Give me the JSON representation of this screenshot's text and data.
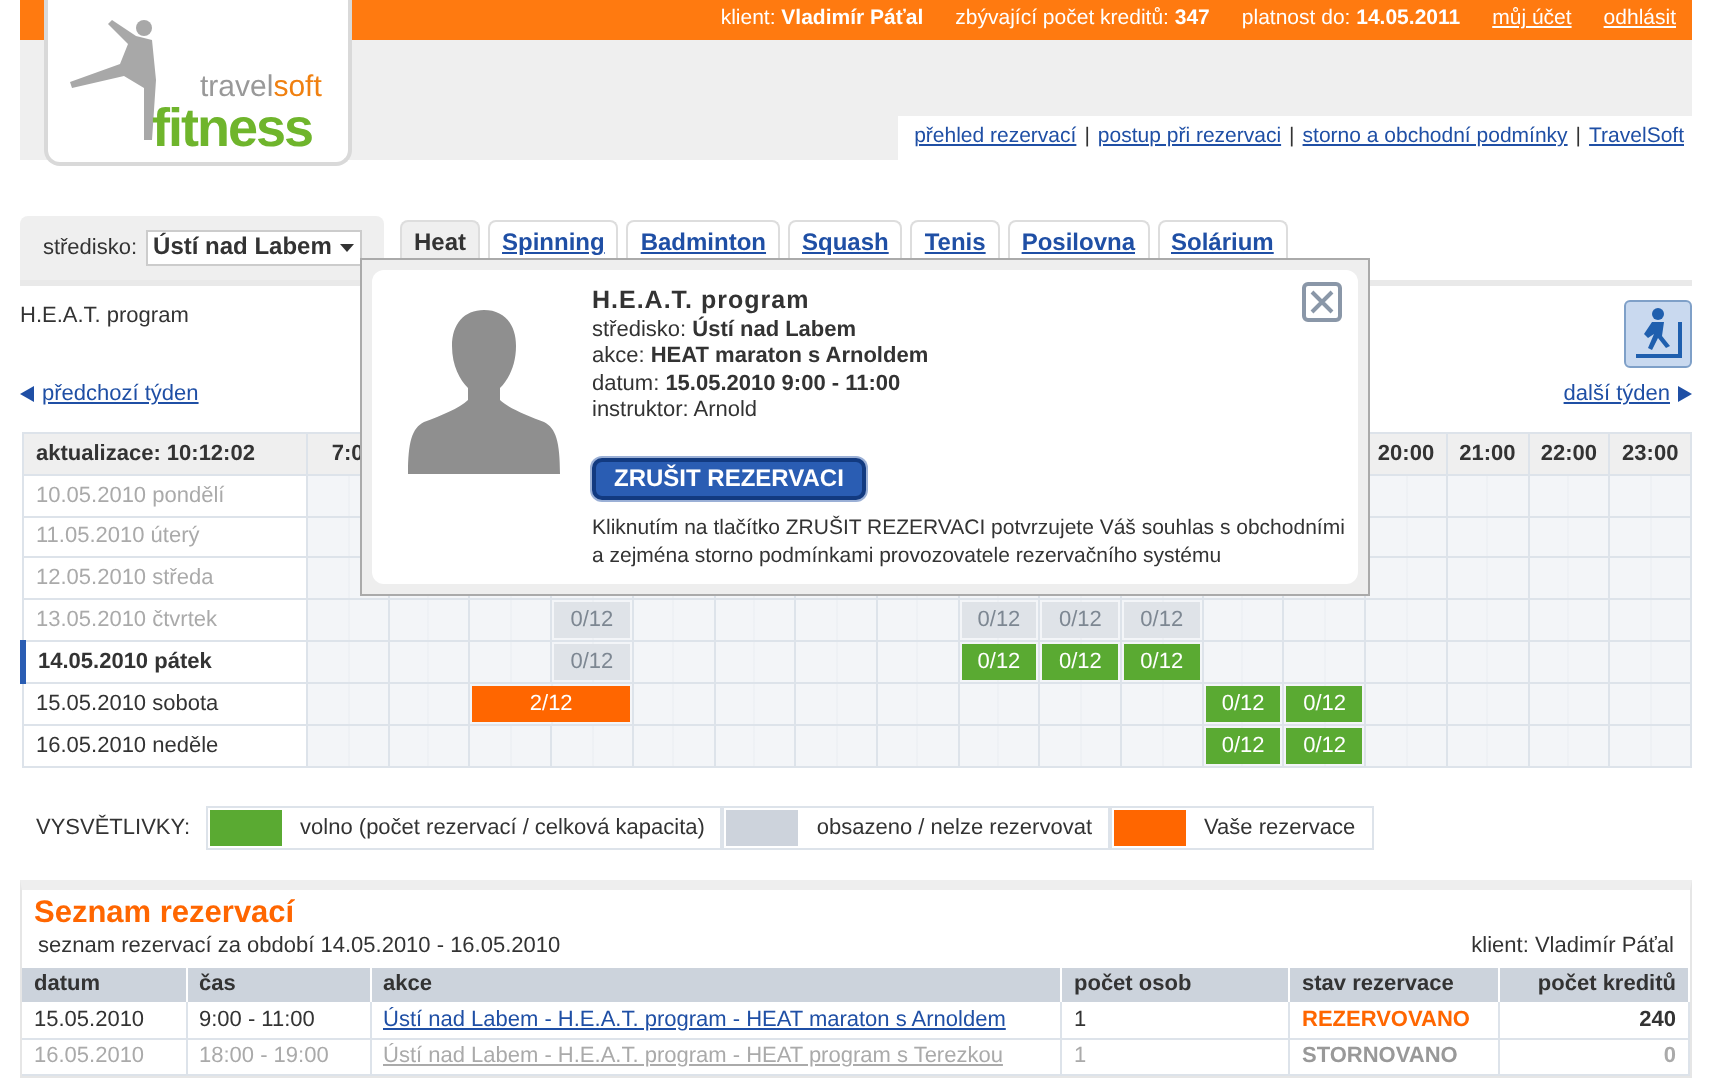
{
  "top_bar": {
    "info": [
      {
        "label": "klient:",
        "value": "Vladimír Páťal"
      },
      {
        "label": "zbývající počet kreditů:",
        "value": "347"
      },
      {
        "label": "platnost do:",
        "value": "14.05.2011"
      }
    ],
    "links": [
      "můj účet",
      "odhlásit"
    ]
  },
  "logo": {
    "part1": "travel",
    "part2": "soft",
    "part3": "fitness"
  },
  "nav_links": [
    "přehled rezervací",
    "postup při rezervaci",
    "storno a obchodní podmínky",
    "TravelSoft"
  ],
  "nav_separator": "|",
  "center": {
    "label": "středisko:",
    "value": "Ústí nad Labem"
  },
  "tabs": [
    {
      "label": "Heat",
      "selected": true
    },
    {
      "label": "Spinning",
      "selected": false
    },
    {
      "label": "Badminton",
      "selected": false
    },
    {
      "label": "Squash",
      "selected": false
    },
    {
      "label": "Tenis",
      "selected": false
    },
    {
      "label": "Posilovna",
      "selected": false
    },
    {
      "label": "Solárium",
      "selected": false
    }
  ],
  "program_title": "H.E.A.T. program",
  "prev_week": "předchozí týden",
  "next_week": "další týden",
  "schedule": {
    "corner": "aktualizace: 10:12:02",
    "hours_start": [
      "7:0"
    ],
    "hours_end": [
      "20:00",
      "21:00",
      "22:00",
      "23:00"
    ],
    "days": [
      {
        "label": "10.05.2010 pondělí",
        "past": true,
        "today": false
      },
      {
        "label": "11.05.2010 úterý",
        "past": true,
        "today": false
      },
      {
        "label": "12.05.2010 středa",
        "past": true,
        "today": false
      },
      {
        "label": "13.05.2010 čtvrtek",
        "past": true,
        "today": false,
        "cells": [
          {
            "kind": "empty"
          },
          {
            "kind": "empty"
          },
          {
            "kind": "empty"
          },
          {
            "kind": "full",
            "text": "0/12"
          },
          {
            "kind": "empty"
          },
          {
            "kind": "empty"
          },
          {
            "kind": "empty"
          },
          {
            "kind": "empty"
          },
          {
            "kind": "full",
            "text": "0/12"
          },
          {
            "kind": "full",
            "text": "0/12"
          },
          {
            "kind": "full",
            "text": "0/12"
          },
          {
            "kind": "empty"
          },
          {
            "kind": "empty"
          },
          {
            "kind": "empty"
          },
          {
            "kind": "empty"
          },
          {
            "kind": "empty"
          },
          {
            "kind": "empty"
          }
        ]
      },
      {
        "label": "14.05.2010 pátek",
        "past": false,
        "today": true,
        "cells": [
          {
            "kind": "empty"
          },
          {
            "kind": "empty"
          },
          {
            "kind": "empty"
          },
          {
            "kind": "full",
            "text": "0/12"
          },
          {
            "kind": "empty"
          },
          {
            "kind": "empty"
          },
          {
            "kind": "empty"
          },
          {
            "kind": "empty"
          },
          {
            "kind": "free",
            "text": "0/12"
          },
          {
            "kind": "free",
            "text": "0/12"
          },
          {
            "kind": "free",
            "text": "0/12"
          },
          {
            "kind": "empty"
          },
          {
            "kind": "empty"
          },
          {
            "kind": "empty"
          },
          {
            "kind": "empty"
          },
          {
            "kind": "empty"
          },
          {
            "kind": "empty"
          }
        ]
      },
      {
        "label": "15.05.2010 sobota",
        "past": false,
        "today": false,
        "cells": [
          {
            "kind": "empty"
          },
          {
            "kind": "empty"
          },
          {
            "kind": "mine",
            "wide": true,
            "text": "2/12"
          },
          {
            "kind": "empty"
          },
          {
            "kind": "empty"
          },
          {
            "kind": "empty"
          },
          {
            "kind": "empty"
          },
          {
            "kind": "empty"
          },
          {
            "kind": "empty"
          },
          {
            "kind": "empty"
          },
          {
            "kind": "free",
            "text": "0/12"
          },
          {
            "kind": "free",
            "text": "0/12"
          },
          {
            "kind": "empty"
          },
          {
            "kind": "empty"
          },
          {
            "kind": "empty"
          },
          {
            "kind": "empty"
          }
        ]
      },
      {
        "label": "16.05.2010 neděle",
        "past": false,
        "today": false,
        "cells": [
          {
            "kind": "empty"
          },
          {
            "kind": "empty"
          },
          {
            "kind": "empty"
          },
          {
            "kind": "empty"
          },
          {
            "kind": "empty"
          },
          {
            "kind": "empty"
          },
          {
            "kind": "empty"
          },
          {
            "kind": "empty"
          },
          {
            "kind": "empty"
          },
          {
            "kind": "empty"
          },
          {
            "kind": "empty"
          },
          {
            "kind": "free",
            "text": "0/12"
          },
          {
            "kind": "free",
            "text": "0/12"
          },
          {
            "kind": "empty"
          },
          {
            "kind": "empty"
          },
          {
            "kind": "empty"
          },
          {
            "kind": "empty"
          }
        ]
      }
    ]
  },
  "popup": {
    "title": "H.E.A.T. program",
    "lines": [
      {
        "label": "středisko:",
        "value": "Ústí nad Labem"
      },
      {
        "label": "akce:",
        "value": "HEAT maraton s Arnoldem"
      },
      {
        "label": "datum:",
        "value": "15.05.2010 9:00 - 11:00"
      },
      {
        "label": "instruktor: Arnold"
      }
    ],
    "button": "ZRUŠIT REZERVACI",
    "note": "Kliknutím na tlačítko ZRUŠIT REZERVACI potvrzujete Váš souhlas s obchodními a zejména storno podmínkami provozovatele rezervačního systému"
  },
  "legend": {
    "title": "VYSVĚTLIVKY:",
    "items": [
      {
        "color": "#5aaa32",
        "text": "volno (počet rezervací / celková kapacita)"
      },
      {
        "color": "#cdd3dc",
        "text": "obsazeno / nelze rezervovat"
      },
      {
        "color": "#ff6600",
        "text": "Vaše rezervace"
      }
    ]
  },
  "reservations": {
    "title": "Seznam rezervací",
    "subtitle": "seznam rezervací za období 14.05.2010 - 16.05.2010",
    "client": "klient: Vladimír Páťal",
    "columns": [
      "datum",
      "čas",
      "akce",
      "počet osob",
      "stav rezervace",
      "počet kreditů"
    ],
    "rows": [
      {
        "cancelled": false,
        "date": "15.05.2010",
        "time": "9:00 - 11:00",
        "event": "Ústí nad Labem - H.E.A.T. program - HEAT maraton s Arnoldem",
        "persons": "1",
        "status": "REZERVOVANO",
        "credits": "240"
      },
      {
        "cancelled": true,
        "date": "16.05.2010",
        "time": "18:00 - 19:00",
        "event": "Ústí nad Labem - H.E.A.T. program - HEAT program s Terezkou",
        "persons": "1",
        "status": "STORNOVANO",
        "credits": "0"
      }
    ]
  }
}
